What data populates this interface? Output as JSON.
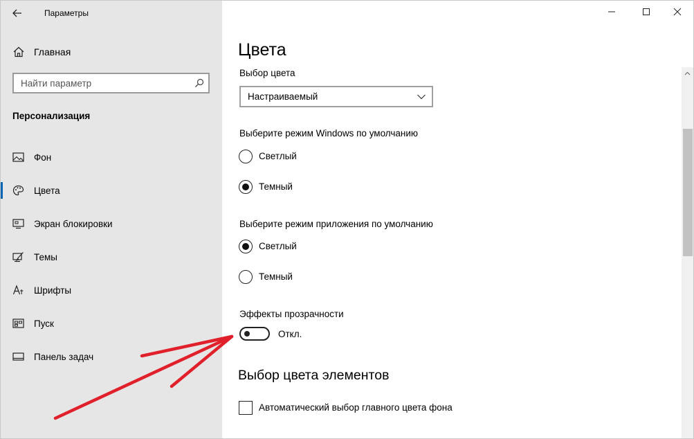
{
  "window": {
    "title": "Параметры",
    "controls": [
      "minimize",
      "maximize",
      "close"
    ]
  },
  "sidebar": {
    "back_icon": "back-arrow-icon",
    "home_label": "Главная",
    "search": {
      "placeholder": "Найти параметр",
      "value": "",
      "icon": "search-icon"
    },
    "section_title": "Персонализация",
    "items": [
      {
        "label": "Фон",
        "icon": "picture-icon",
        "active": false
      },
      {
        "label": "Цвета",
        "icon": "palette-icon",
        "active": true
      },
      {
        "label": "Экран блокировки",
        "icon": "monitor-icon",
        "active": false
      },
      {
        "label": "Темы",
        "icon": "brush-icon",
        "active": false
      },
      {
        "label": "Шрифты",
        "icon": "font-icon",
        "active": false
      },
      {
        "label": "Пуск",
        "icon": "start-icon",
        "active": false
      },
      {
        "label": "Панель задач",
        "icon": "taskbar-icon",
        "active": false
      }
    ]
  },
  "main": {
    "title": "Цвета",
    "color_choice": {
      "label": "Выбор цвета",
      "value": "Настраиваемый"
    },
    "windows_mode": {
      "label": "Выберите режим Windows по умолчанию",
      "options": [
        {
          "label": "Светлый",
          "selected": false
        },
        {
          "label": "Темный",
          "selected": true
        }
      ]
    },
    "app_mode": {
      "label": "Выберите режим приложения по умолчанию",
      "options": [
        {
          "label": "Светлый",
          "selected": true
        },
        {
          "label": "Темный",
          "selected": false
        }
      ]
    },
    "transparency": {
      "label": "Эффекты прозрачности",
      "state_label": "Откл.",
      "on": false
    },
    "accent_heading": "Выбор цвета элементов",
    "auto_accent": {
      "label": "Автоматический выбор главного цвета фона",
      "checked": false
    }
  },
  "colors": {
    "sidebar_bg": "#e6e6e6",
    "accent": "#0063b1",
    "annotation_arrow": "#e0202a"
  }
}
